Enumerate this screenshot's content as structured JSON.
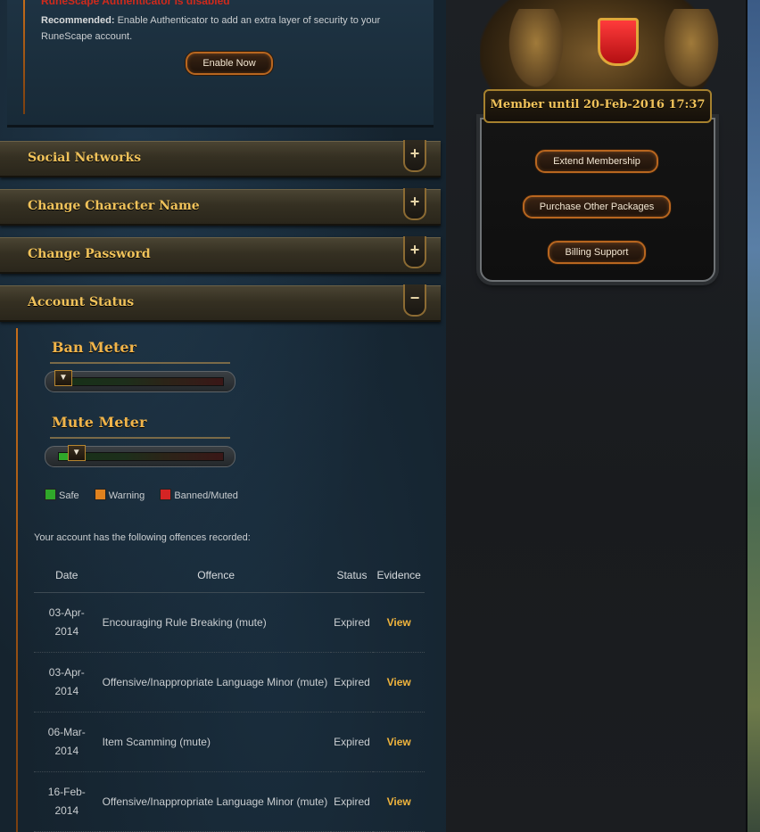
{
  "authenticator": {
    "warning": "RuneScape Authenticator is disabled",
    "recommended_label": "Recommended:",
    "recommended_text": "Enable Authenticator to add an extra layer of security to your RuneScape account.",
    "enable_button": "Enable Now"
  },
  "sections": [
    {
      "title": "Social Networks",
      "toggle": "+"
    },
    {
      "title": "Change Character Name",
      "toggle": "+"
    },
    {
      "title": "Change Password",
      "toggle": "+"
    },
    {
      "title": "Account Status",
      "toggle": "−"
    }
  ],
  "account_status": {
    "ban_meter": {
      "title": "Ban Meter",
      "level": 0.0
    },
    "mute_meter": {
      "title": "Mute Meter",
      "level": 0.08
    },
    "legend": {
      "safe": "Safe",
      "warning": "Warning",
      "banned": "Banned/Muted"
    },
    "intro": "Your account has the following offences recorded:",
    "table": {
      "headers": {
        "date": "Date",
        "offence": "Offence",
        "status": "Status",
        "evidence": "Evidence"
      },
      "rows": [
        {
          "date_line1": "03-Apr-",
          "date_line2": "2014",
          "offence": "Encouraging Rule Breaking (mute)",
          "status": "Expired",
          "evidence": "View"
        },
        {
          "date_line1": "03-Apr-",
          "date_line2": "2014",
          "offence": "Offensive/Inappropriate Language Minor (mute)",
          "status": "Expired",
          "evidence": "View"
        },
        {
          "date_line1": "06-Mar-",
          "date_line2": "2014",
          "offence": "Item Scamming (mute)",
          "status": "Expired",
          "evidence": "View"
        },
        {
          "date_line1": "16-Feb-",
          "date_line2": "2014",
          "offence": "Offensive/Inappropriate Language Minor (mute)",
          "status": "Expired",
          "evidence": "View"
        }
      ]
    }
  },
  "membership": {
    "banner": "Member until 20-Feb-2016 17:37",
    "extend_button": "Extend Membership",
    "packages_button": "Purchase Other Packages",
    "billing_button": "Billing Support"
  },
  "colors": {
    "accent_gold": "#f0c25a",
    "link_orange": "#f0b43c",
    "warning_red": "#d02a1c",
    "safe_green": "#2fa82a",
    "warning_orange": "#e0821e",
    "banned_red": "#d42424"
  }
}
